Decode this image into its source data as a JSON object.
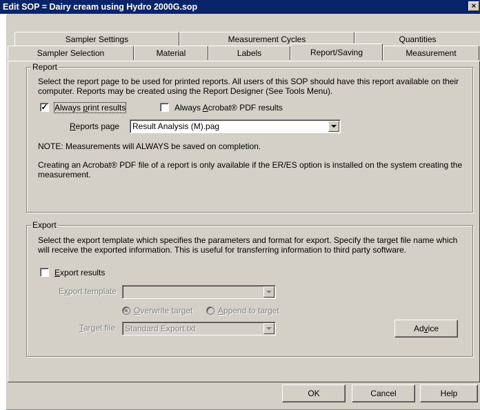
{
  "window": {
    "title": "Edit SOP = Dairy cream using Hydro 2000G.sop",
    "close_glyph": "×"
  },
  "tabs": {
    "row1": [
      "Sampler Settings",
      "Measurement Cycles",
      "Quantities"
    ],
    "row2": [
      "Sampler Selection",
      "Material",
      "Labels",
      "Report/Saving",
      "Measurement"
    ],
    "active": "Report/Saving"
  },
  "report": {
    "legend": "Report",
    "description": "Select the report page to be used for printed reports. All users of this SOP should have this report available on their computer. Reports may be created using the Report Designer (See Tools Menu).",
    "always_print": {
      "label_pre": "Always ",
      "label_ul": "p",
      "label_post": "rint results",
      "checked": true,
      "check_glyph": "✓"
    },
    "always_pdf": {
      "label_pre": "Always ",
      "label_ul": "A",
      "label_post": "crobat® PDF results",
      "checked": false
    },
    "reports_page": {
      "label_ul": "R",
      "label_rest": "eports page",
      "value": "Result Analysis (M).pag"
    },
    "note": "NOTE: Measurements will ALWAYS be saved on completion.",
    "pdf_note": "Creating an Acrobat® PDF file of a report is only available if the ER/ES option is installed on the system creating the measurement."
  },
  "export": {
    "legend": "Export",
    "description": "Select the export template which specifies the parameters and format for export. Specify the target file name which will receive the exported information. This is useful for transferring information to third party software.",
    "export_results": {
      "label_ul": "E",
      "label_rest": "xport results",
      "checked": false
    },
    "template": {
      "label_pre": "E",
      "label_ul": "x",
      "label_post": "port template",
      "value": ""
    },
    "overwrite": {
      "label_ul": "O",
      "label_rest": "verwrite target",
      "selected": true
    },
    "append": {
      "label_ul": "A",
      "label_rest": "ppend to target",
      "selected": false
    },
    "target_file": {
      "label_ul": "T",
      "label_rest": "arget file",
      "value": "Standard Export.txt"
    },
    "advice": {
      "label_pre": "Ad",
      "label_ul": "v",
      "label_post": "ice"
    }
  },
  "buttons": {
    "ok": "OK",
    "cancel": "Cancel",
    "help": "Help"
  }
}
